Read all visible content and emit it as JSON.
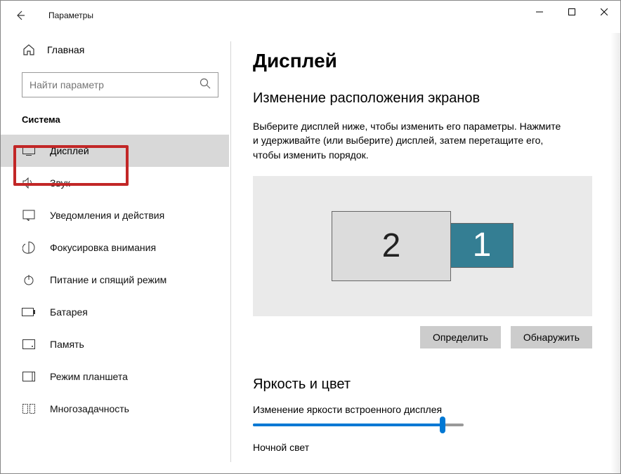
{
  "titlebar": {
    "title": "Параметры"
  },
  "sidebar": {
    "home_label": "Главная",
    "search_placeholder": "Найти параметр",
    "section_label": "Система",
    "items": [
      {
        "label": "Дисплей"
      },
      {
        "label": "Звук"
      },
      {
        "label": "Уведомления и действия"
      },
      {
        "label": "Фокусировка внимания"
      },
      {
        "label": "Питание и спящий режим"
      },
      {
        "label": "Батарея"
      },
      {
        "label": "Память"
      },
      {
        "label": "Режим планшета"
      },
      {
        "label": "Многозадачность"
      }
    ]
  },
  "main": {
    "heading": "Дисплей",
    "subheading": "Изменение расположения экранов",
    "description": "Выберите дисплей ниже, чтобы изменить его параметры. Нажмите и удерживайте (или выберите) дисплей, затем перетащите его, чтобы изменить порядок.",
    "display1_label": "1",
    "display2_label": "2",
    "identify_btn": "Определить",
    "detect_btn": "Обнаружить",
    "brightness_heading": "Яркость и цвет",
    "brightness_label": "Изменение яркости встроенного дисплея",
    "night_light_label": "Ночной свет"
  }
}
